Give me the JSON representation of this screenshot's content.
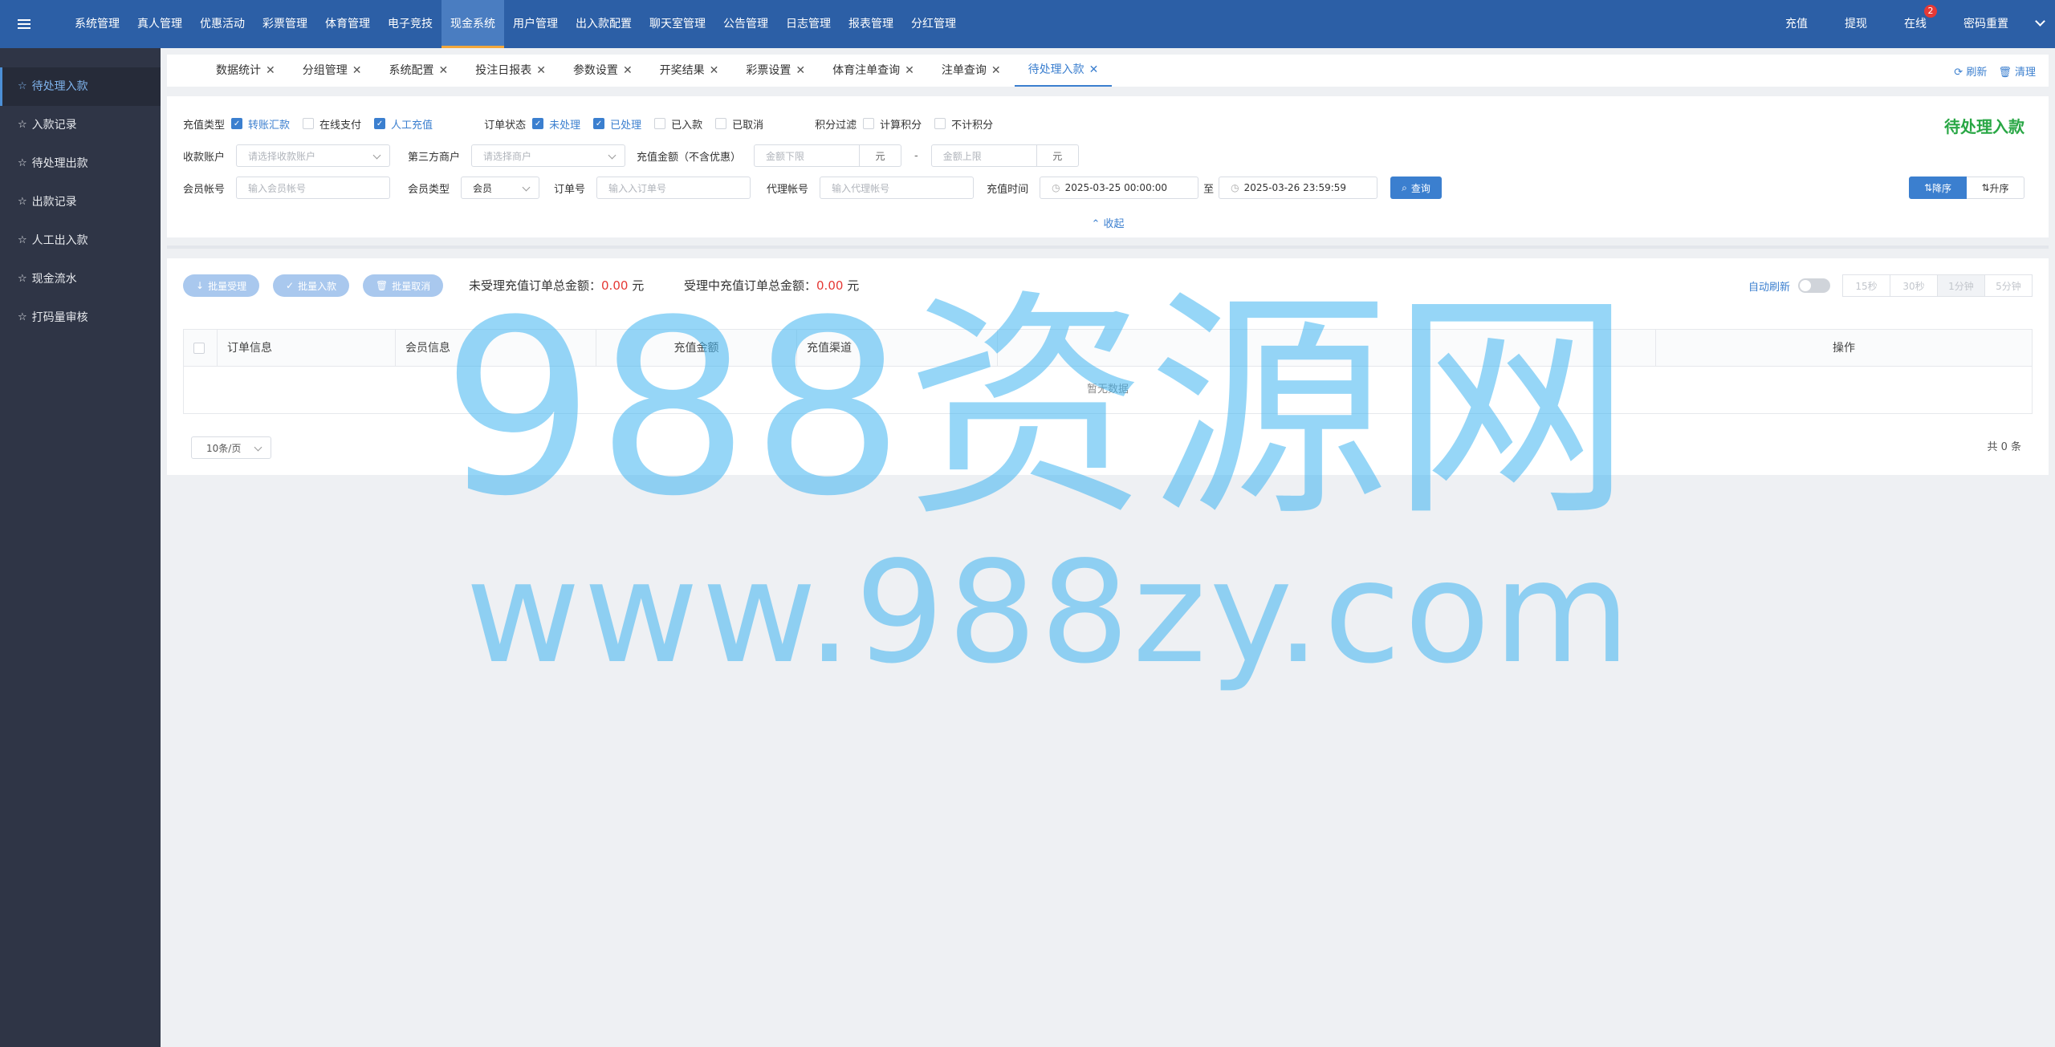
{
  "topnav": {
    "items": [
      "系统管理",
      "真人管理",
      "优惠活动",
      "彩票管理",
      "体育管理",
      "电子竞技",
      "现金系统",
      "用户管理",
      "出入款配置",
      "聊天室管理",
      "公告管理",
      "日志管理",
      "报表管理",
      "分红管理"
    ],
    "active_index": 6,
    "right": {
      "deposit": "充值",
      "withdraw": "提现",
      "online": "在线",
      "online_badge": "2",
      "password_reset": "密码重置"
    }
  },
  "sidebar": {
    "items": [
      "待处理入款",
      "入款记录",
      "待处理出款",
      "出款记录",
      "人工出入款",
      "现金流水",
      "打码量审核"
    ],
    "active_index": 0
  },
  "tabs": {
    "items": [
      "数据统计",
      "分组管理",
      "系统配置",
      "投注日报表",
      "参数设置",
      "开奖结果",
      "彩票设置",
      "体育注单查询",
      "注单查询",
      "待处理入款"
    ],
    "active_index": 9,
    "refresh": "刷新",
    "clear": "清理"
  },
  "filters": {
    "page_title": "待处理入款",
    "recharge_type_label": "充值类型",
    "recharge_types": [
      {
        "label": "转账汇款",
        "checked": true
      },
      {
        "label": "在线支付",
        "checked": false
      },
      {
        "label": "人工充值",
        "checked": true
      }
    ],
    "order_status_label": "订单状态",
    "order_statuses": [
      {
        "label": "未处理",
        "checked": true
      },
      {
        "label": "已处理",
        "checked": true
      },
      {
        "label": "已入款",
        "checked": false
      },
      {
        "label": "已取消",
        "checked": false
      }
    ],
    "points_label": "积分过滤",
    "points": [
      {
        "label": "计算积分",
        "checked": false
      },
      {
        "label": "不计积分",
        "checked": false
      }
    ],
    "receive_account_label": "收款账户",
    "receive_account_placeholder": "请选择收款账户",
    "merchant_label": "第三方商户",
    "merchant_placeholder": "请选择商户",
    "amount_label": "充值金额（不含优惠）",
    "amount_min_placeholder": "金额下限",
    "amount_max_placeholder": "金额上限",
    "unit": "元",
    "range_dash": "-",
    "member_account_label": "会员帐号",
    "member_account_placeholder": "输入会员帐号",
    "member_type_label": "会员类型",
    "member_type_value": "会员",
    "order_no_label": "订单号",
    "order_no_placeholder": "输入入订单号",
    "agent_label": "代理帐号",
    "agent_placeholder": "输入代理帐号",
    "time_label": "充值时间",
    "time_start": "2025-03-25 00:00:00",
    "time_to": "至",
    "time_end": "2025-03-26 23:59:59",
    "query_button": "查询",
    "sort_desc": "降序",
    "sort_asc": "升序",
    "collapse": "收起"
  },
  "data_panel": {
    "batch_accept": "批量受理",
    "batch_deposit": "批量入款",
    "batch_cancel": "批量取消",
    "unaccepted_label": "未受理充值订单总金额：",
    "unaccepted_value": "0.00",
    "accepting_label": "受理中充值订单总金额：",
    "accepting_value": "0.00",
    "currency": "元",
    "auto_refresh": "自动刷新",
    "intervals": [
      "15秒",
      "30秒",
      "1分钟",
      "5分钟"
    ],
    "interval_selected": 2,
    "columns": [
      "订单信息",
      "会员信息",
      "充值金额",
      "充值渠道",
      "",
      "操作"
    ],
    "empty_text": "暂无数据",
    "page_size": "10条/页",
    "total": "共 0 条"
  },
  "watermark": {
    "line1": "988资源网",
    "line2": "www.988zy.com"
  }
}
